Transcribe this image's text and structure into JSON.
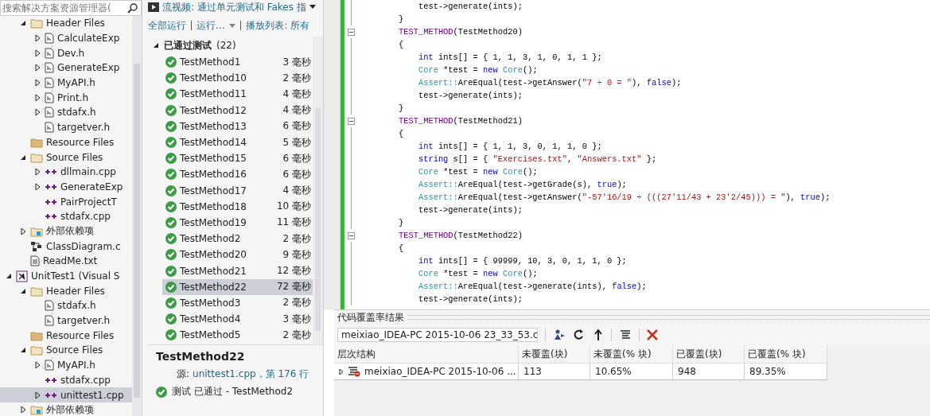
{
  "solution_explorer": {
    "search": {
      "placeholder": "搜索解决方案资源管理器("
    },
    "items": [
      {
        "label": "Header Files",
        "kind": "folder",
        "expanded": true,
        "children": [
          {
            "label": "CalculateExp",
            "kind": "header",
            "expanded": false
          },
          {
            "label": "Dev.h",
            "kind": "header",
            "expanded": false
          },
          {
            "label": "GenerateExp",
            "kind": "header",
            "expanded": false
          },
          {
            "label": "MyAPI.h",
            "kind": "header",
            "expanded": false
          },
          {
            "label": "Print.h",
            "kind": "header",
            "expanded": false
          },
          {
            "label": "stdafx.h",
            "kind": "header",
            "expanded": false
          },
          {
            "label": "targetver.h",
            "kind": "header"
          }
        ]
      },
      {
        "label": "Resource Files",
        "kind": "folder-full"
      },
      {
        "label": "Source Files",
        "kind": "folder",
        "expanded": true,
        "children": [
          {
            "label": "dllmain.cpp",
            "kind": "cpp",
            "expanded": false
          },
          {
            "label": "GenerateExp",
            "kind": "cpp",
            "expanded": false
          },
          {
            "label": "PairProjectT",
            "kind": "cpp"
          },
          {
            "label": "stdafx.cpp",
            "kind": "cpp"
          }
        ]
      },
      {
        "label": "外部依赖项",
        "kind": "refs",
        "expanded": false
      },
      {
        "label": "ClassDiagram.c",
        "kind": "diagram"
      },
      {
        "label": "ReadMe.txt",
        "kind": "text"
      },
      {
        "label": "UnitTest1 (Visual S",
        "kind": "project",
        "root": true,
        "expanded": true,
        "children": [
          {
            "label": "Header Files",
            "kind": "folder",
            "expanded": true,
            "children": [
              {
                "label": "stdafx.h",
                "kind": "header"
              },
              {
                "label": "targetver.h",
                "kind": "header"
              }
            ]
          },
          {
            "label": "Resource Files",
            "kind": "folder-full"
          },
          {
            "label": "Source Files",
            "kind": "folder",
            "expanded": true,
            "children": [
              {
                "label": "MyAPI.h",
                "kind": "header",
                "expanded": false
              },
              {
                "label": "stdafx.cpp",
                "kind": "cpp"
              },
              {
                "label": "unittest1.cpp",
                "kind": "cpp",
                "expanded": false,
                "selected": true
              }
            ]
          },
          {
            "label": "外部依赖项",
            "kind": "refs",
            "expanded": false
          }
        ]
      }
    ]
  },
  "test_explorer": {
    "video_link": "流视频: 通过单元测试和 Fakes 指",
    "toolbar": [
      "全部运行",
      "运行...",
      "播放列表: 所有"
    ],
    "group": {
      "label": "已通过测试",
      "count": "(22)",
      "expanded": true
    },
    "tests": [
      {
        "name": "TestMethod1",
        "time": "3 毫秒",
        "selected": false
      },
      {
        "name": "TestMethod10",
        "time": "2 毫秒",
        "selected": false
      },
      {
        "name": "TestMethod11",
        "time": "4 毫秒",
        "selected": false
      },
      {
        "name": "TestMethod12",
        "time": "4 毫秒",
        "selected": false
      },
      {
        "name": "TestMethod13",
        "time": "6 毫秒",
        "selected": false
      },
      {
        "name": "TestMethod14",
        "time": "5 毫秒",
        "selected": false
      },
      {
        "name": "TestMethod15",
        "time": "6 毫秒",
        "selected": false
      },
      {
        "name": "TestMethod16",
        "time": "6 毫秒",
        "selected": false
      },
      {
        "name": "TestMethod17",
        "time": "4 毫秒",
        "selected": false
      },
      {
        "name": "TestMethod18",
        "time": "10 毫秒",
        "selected": false
      },
      {
        "name": "TestMethod19",
        "time": "11 毫秒",
        "selected": false
      },
      {
        "name": "TestMethod2",
        "time": "2 毫秒",
        "selected": false
      },
      {
        "name": "TestMethod20",
        "time": "9 毫秒",
        "selected": false
      },
      {
        "name": "TestMethod21",
        "time": "12 毫秒",
        "selected": false
      },
      {
        "name": "TestMethod22",
        "time": "72 毫秒",
        "selected": true
      },
      {
        "name": "TestMethod3",
        "time": "2 毫秒",
        "selected": false
      },
      {
        "name": "TestMethod4",
        "time": "3 毫秒",
        "selected": false
      },
      {
        "name": "TestMethod5",
        "time": "2 毫秒",
        "selected": false
      }
    ],
    "detail": {
      "title": "TestMethod22",
      "source_label": "源:",
      "source_link": "unittest1.cpp，第 176 行",
      "result": "测试 已通过 - TestMethod2"
    }
  },
  "editor": {
    "lines": [
      {
        "fold": false,
        "tokens": [
          {
            "kind": "plain",
            "text": "    test->generate(ints);"
          }
        ]
      },
      {
        "fold": false,
        "tokens": [
          {
            "kind": "plain",
            "text": "}"
          }
        ]
      },
      {
        "fold": true,
        "tokens": [
          {
            "kind": "macro",
            "text": "TEST_METHOD"
          },
          {
            "kind": "plain",
            "text": "(TestMethod20)"
          }
        ]
      },
      {
        "fold": false,
        "tokens": [
          {
            "kind": "plain",
            "text": "{"
          }
        ]
      },
      {
        "fold": false,
        "tokens": [
          {
            "kind": "keyword",
            "text": "    int"
          },
          {
            "kind": "plain",
            "text": " ints[] = { 1, 1, 3, 1, 0, 1, 1 };"
          }
        ]
      },
      {
        "fold": false,
        "tokens": [
          {
            "kind": "type",
            "text": "    Core"
          },
          {
            "kind": "plain",
            "text": " *test = "
          },
          {
            "kind": "keyword",
            "text": "new"
          },
          {
            "kind": "type",
            "text": " Core"
          },
          {
            "kind": "plain",
            "text": "();"
          }
        ]
      },
      {
        "fold": false,
        "tokens": [
          {
            "kind": "type",
            "text": "    Assert::"
          },
          {
            "kind": "plain",
            "text": "AreEqual(test->getAnswer("
          },
          {
            "kind": "string",
            "text": "\"7 ÷ 0 = \""
          },
          {
            "kind": "plain",
            "text": "), "
          },
          {
            "kind": "keyword",
            "text": "false"
          },
          {
            "kind": "plain",
            "text": ");"
          }
        ]
      },
      {
        "fold": false,
        "tokens": [
          {
            "kind": "plain",
            "text": "    test->generate(ints);"
          }
        ]
      },
      {
        "fold": false,
        "tokens": [
          {
            "kind": "plain",
            "text": "}"
          }
        ]
      },
      {
        "fold": true,
        "tokens": [
          {
            "kind": "macro",
            "text": "TEST_METHOD"
          },
          {
            "kind": "plain",
            "text": "(TestMethod21)"
          }
        ]
      },
      {
        "fold": false,
        "tokens": [
          {
            "kind": "plain",
            "text": "{"
          }
        ]
      },
      {
        "fold": false,
        "tokens": [
          {
            "kind": "keyword",
            "text": "    int"
          },
          {
            "kind": "plain",
            "text": " ints[] = { 1, 1, 3, 0, 1, 1, 0 };"
          }
        ]
      },
      {
        "fold": false,
        "tokens": [
          {
            "kind": "keyword",
            "text": "    string"
          },
          {
            "kind": "plain",
            "text": " s[] = { "
          },
          {
            "kind": "string",
            "text": "\"Exercises.txt\""
          },
          {
            "kind": "plain",
            "text": ", "
          },
          {
            "kind": "string",
            "text": "\"Answers.txt\""
          },
          {
            "kind": "plain",
            "text": " };"
          }
        ]
      },
      {
        "fold": false,
        "tokens": [
          {
            "kind": "type",
            "text": "    Core"
          },
          {
            "kind": "plain",
            "text": " *test = "
          },
          {
            "kind": "keyword",
            "text": "new"
          },
          {
            "kind": "type",
            "text": " Core"
          },
          {
            "kind": "plain",
            "text": "();"
          }
        ]
      },
      {
        "fold": false,
        "tokens": [
          {
            "kind": "type",
            "text": "    Assert::"
          },
          {
            "kind": "plain",
            "text": "AreEqual(test->getGrade(s), "
          },
          {
            "kind": "keyword",
            "text": "true"
          },
          {
            "kind": "plain",
            "text": ");"
          }
        ]
      },
      {
        "fold": false,
        "tokens": [
          {
            "kind": "type",
            "text": "    Assert::"
          },
          {
            "kind": "plain",
            "text": "AreEqual(test->getAnswer("
          },
          {
            "kind": "string",
            "text": "\"-57'16/19 ÷ (((27'11/43 + 23'2/45))) = \""
          },
          {
            "kind": "plain",
            "text": "), "
          },
          {
            "kind": "keyword",
            "text": "true"
          },
          {
            "kind": "plain",
            "text": ");"
          }
        ]
      },
      {
        "fold": false,
        "tokens": [
          {
            "kind": "plain",
            "text": "    test->generate(ints);"
          }
        ]
      },
      {
        "fold": false,
        "tokens": [
          {
            "kind": "plain",
            "text": "}"
          }
        ]
      },
      {
        "fold": true,
        "tokens": [
          {
            "kind": "macro",
            "text": "TEST_METHOD"
          },
          {
            "kind": "plain",
            "text": "(TestMethod22)"
          }
        ]
      },
      {
        "fold": false,
        "tokens": [
          {
            "kind": "plain",
            "text": "{"
          }
        ]
      },
      {
        "fold": false,
        "tokens": [
          {
            "kind": "keyword",
            "text": "    int"
          },
          {
            "kind": "plain",
            "text": " ints[] = { 99999, 10, 3, 0, 1, 1, 0 };"
          }
        ]
      },
      {
        "fold": false,
        "tokens": [
          {
            "kind": "type",
            "text": "    Core"
          },
          {
            "kind": "plain",
            "text": " *test = "
          },
          {
            "kind": "keyword",
            "text": "new"
          },
          {
            "kind": "type",
            "text": " Core"
          },
          {
            "kind": "plain",
            "text": "();"
          }
        ]
      },
      {
        "fold": false,
        "tokens": [
          {
            "kind": "type",
            "text": "    Assert::"
          },
          {
            "kind": "plain",
            "text": "AreEqual(test->generate(ints), "
          },
          {
            "kind": "keyword",
            "text": "false"
          },
          {
            "kind": "plain",
            "text": ");"
          }
        ]
      },
      {
        "fold": false,
        "tokens": [
          {
            "kind": "plain",
            "text": "    test->generate(ints);"
          }
        ]
      }
    ]
  },
  "coverage": {
    "title": "代码覆盖率结果",
    "run_select": "meixiao_IDEA-PC 2015-10-06 23_33_53.c",
    "columns": [
      "层次结构",
      "未覆盖(块)",
      "未覆盖(% 块)",
      "已覆盖(块)",
      "已覆盖(% 块)"
    ],
    "rows": [
      {
        "expanded": false,
        "cells": [
          "meixiao_IDEA-PC 2015-10-06 ...",
          "113",
          "10.65%",
          "948",
          "89.35%"
        ]
      }
    ]
  }
}
